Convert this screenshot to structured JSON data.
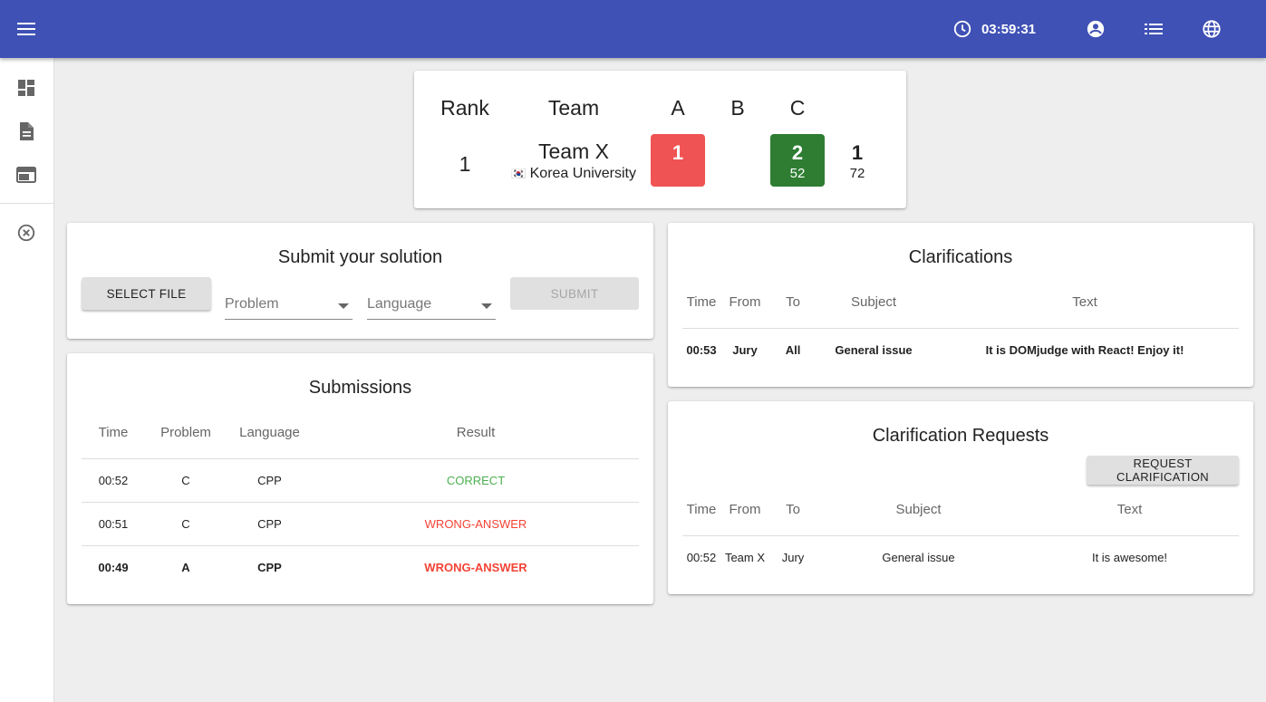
{
  "header": {
    "timer": "03:59:31",
    "icons": [
      "menu-icon",
      "clock-icon",
      "account-circle-icon",
      "list-icon",
      "globe-icon"
    ],
    "color": "#3f51b5"
  },
  "sidebar": {
    "items": [
      {
        "icon": "dashboard-icon"
      },
      {
        "icon": "description-icon"
      },
      {
        "icon": "web-icon"
      },
      {
        "icon": "cancel-icon"
      }
    ]
  },
  "scoreboard": {
    "headers": {
      "rank": "Rank",
      "team": "Team",
      "problems": [
        "A",
        "B",
        "C"
      ]
    },
    "row": {
      "rank": "1",
      "team_name": "Team X",
      "flag": "🇰🇷",
      "affiliation": "Korea University",
      "problems": [
        {
          "tries": "1",
          "time": "",
          "status": "wrong",
          "color": "#f05353"
        },
        {
          "tries": "",
          "time": "",
          "status": "none"
        },
        {
          "tries": "2",
          "time": "52",
          "status": "solved",
          "color": "#2e7d32"
        }
      ],
      "solved": "1",
      "penalty": "72"
    }
  },
  "submit": {
    "title": "Submit your solution",
    "select_file": "SELECT FILE",
    "problem_placeholder": "Problem",
    "language_placeholder": "Language",
    "submit_label": "SUBMIT"
  },
  "submissions": {
    "title": "Submissions",
    "columns": [
      "Time",
      "Problem",
      "Language",
      "Result"
    ],
    "rows": [
      {
        "time": "00:52",
        "problem": "C",
        "language": "CPP",
        "result": "CORRECT"
      },
      {
        "time": "00:51",
        "problem": "C",
        "language": "CPP",
        "result": "WRONG-ANSWER"
      },
      {
        "time": "00:49",
        "problem": "A",
        "language": "CPP",
        "result": "WRONG-ANSWER"
      }
    ]
  },
  "clarifications": {
    "title": "Clarifications",
    "columns": [
      "Time",
      "From",
      "To",
      "Subject",
      "Text"
    ],
    "rows": [
      {
        "time": "00:53",
        "from": "Jury",
        "to": "All",
        "subject": "General issue",
        "text": "It is DOMjudge with React! Enjoy it!"
      }
    ]
  },
  "requests": {
    "title": "Clarification Requests",
    "button": "REQUEST CLARIFICATION",
    "columns": [
      "Time",
      "From",
      "To",
      "Subject",
      "Text"
    ],
    "rows": [
      {
        "time": "00:52",
        "from": "Team X",
        "to": "Jury",
        "subject": "General issue",
        "text": "It is awesome!"
      }
    ]
  }
}
